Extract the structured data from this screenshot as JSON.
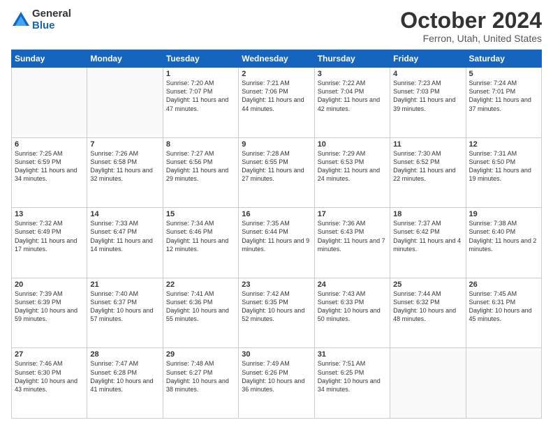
{
  "header": {
    "logo_general": "General",
    "logo_blue": "Blue",
    "month_title": "October 2024",
    "location": "Ferron, Utah, United States"
  },
  "days_of_week": [
    "Sunday",
    "Monday",
    "Tuesday",
    "Wednesday",
    "Thursday",
    "Friday",
    "Saturday"
  ],
  "weeks": [
    [
      {
        "num": "",
        "sunrise": "",
        "sunset": "",
        "daylight": ""
      },
      {
        "num": "",
        "sunrise": "",
        "sunset": "",
        "daylight": ""
      },
      {
        "num": "1",
        "sunrise": "Sunrise: 7:20 AM",
        "sunset": "Sunset: 7:07 PM",
        "daylight": "Daylight: 11 hours and 47 minutes."
      },
      {
        "num": "2",
        "sunrise": "Sunrise: 7:21 AM",
        "sunset": "Sunset: 7:06 PM",
        "daylight": "Daylight: 11 hours and 44 minutes."
      },
      {
        "num": "3",
        "sunrise": "Sunrise: 7:22 AM",
        "sunset": "Sunset: 7:04 PM",
        "daylight": "Daylight: 11 hours and 42 minutes."
      },
      {
        "num": "4",
        "sunrise": "Sunrise: 7:23 AM",
        "sunset": "Sunset: 7:03 PM",
        "daylight": "Daylight: 11 hours and 39 minutes."
      },
      {
        "num": "5",
        "sunrise": "Sunrise: 7:24 AM",
        "sunset": "Sunset: 7:01 PM",
        "daylight": "Daylight: 11 hours and 37 minutes."
      }
    ],
    [
      {
        "num": "6",
        "sunrise": "Sunrise: 7:25 AM",
        "sunset": "Sunset: 6:59 PM",
        "daylight": "Daylight: 11 hours and 34 minutes."
      },
      {
        "num": "7",
        "sunrise": "Sunrise: 7:26 AM",
        "sunset": "Sunset: 6:58 PM",
        "daylight": "Daylight: 11 hours and 32 minutes."
      },
      {
        "num": "8",
        "sunrise": "Sunrise: 7:27 AM",
        "sunset": "Sunset: 6:56 PM",
        "daylight": "Daylight: 11 hours and 29 minutes."
      },
      {
        "num": "9",
        "sunrise": "Sunrise: 7:28 AM",
        "sunset": "Sunset: 6:55 PM",
        "daylight": "Daylight: 11 hours and 27 minutes."
      },
      {
        "num": "10",
        "sunrise": "Sunrise: 7:29 AM",
        "sunset": "Sunset: 6:53 PM",
        "daylight": "Daylight: 11 hours and 24 minutes."
      },
      {
        "num": "11",
        "sunrise": "Sunrise: 7:30 AM",
        "sunset": "Sunset: 6:52 PM",
        "daylight": "Daylight: 11 hours and 22 minutes."
      },
      {
        "num": "12",
        "sunrise": "Sunrise: 7:31 AM",
        "sunset": "Sunset: 6:50 PM",
        "daylight": "Daylight: 11 hours and 19 minutes."
      }
    ],
    [
      {
        "num": "13",
        "sunrise": "Sunrise: 7:32 AM",
        "sunset": "Sunset: 6:49 PM",
        "daylight": "Daylight: 11 hours and 17 minutes."
      },
      {
        "num": "14",
        "sunrise": "Sunrise: 7:33 AM",
        "sunset": "Sunset: 6:47 PM",
        "daylight": "Daylight: 11 hours and 14 minutes."
      },
      {
        "num": "15",
        "sunrise": "Sunrise: 7:34 AM",
        "sunset": "Sunset: 6:46 PM",
        "daylight": "Daylight: 11 hours and 12 minutes."
      },
      {
        "num": "16",
        "sunrise": "Sunrise: 7:35 AM",
        "sunset": "Sunset: 6:44 PM",
        "daylight": "Daylight: 11 hours and 9 minutes."
      },
      {
        "num": "17",
        "sunrise": "Sunrise: 7:36 AM",
        "sunset": "Sunset: 6:43 PM",
        "daylight": "Daylight: 11 hours and 7 minutes."
      },
      {
        "num": "18",
        "sunrise": "Sunrise: 7:37 AM",
        "sunset": "Sunset: 6:42 PM",
        "daylight": "Daylight: 11 hours and 4 minutes."
      },
      {
        "num": "19",
        "sunrise": "Sunrise: 7:38 AM",
        "sunset": "Sunset: 6:40 PM",
        "daylight": "Daylight: 11 hours and 2 minutes."
      }
    ],
    [
      {
        "num": "20",
        "sunrise": "Sunrise: 7:39 AM",
        "sunset": "Sunset: 6:39 PM",
        "daylight": "Daylight: 10 hours and 59 minutes."
      },
      {
        "num": "21",
        "sunrise": "Sunrise: 7:40 AM",
        "sunset": "Sunset: 6:37 PM",
        "daylight": "Daylight: 10 hours and 57 minutes."
      },
      {
        "num": "22",
        "sunrise": "Sunrise: 7:41 AM",
        "sunset": "Sunset: 6:36 PM",
        "daylight": "Daylight: 10 hours and 55 minutes."
      },
      {
        "num": "23",
        "sunrise": "Sunrise: 7:42 AM",
        "sunset": "Sunset: 6:35 PM",
        "daylight": "Daylight: 10 hours and 52 minutes."
      },
      {
        "num": "24",
        "sunrise": "Sunrise: 7:43 AM",
        "sunset": "Sunset: 6:33 PM",
        "daylight": "Daylight: 10 hours and 50 minutes."
      },
      {
        "num": "25",
        "sunrise": "Sunrise: 7:44 AM",
        "sunset": "Sunset: 6:32 PM",
        "daylight": "Daylight: 10 hours and 48 minutes."
      },
      {
        "num": "26",
        "sunrise": "Sunrise: 7:45 AM",
        "sunset": "Sunset: 6:31 PM",
        "daylight": "Daylight: 10 hours and 45 minutes."
      }
    ],
    [
      {
        "num": "27",
        "sunrise": "Sunrise: 7:46 AM",
        "sunset": "Sunset: 6:30 PM",
        "daylight": "Daylight: 10 hours and 43 minutes."
      },
      {
        "num": "28",
        "sunrise": "Sunrise: 7:47 AM",
        "sunset": "Sunset: 6:28 PM",
        "daylight": "Daylight: 10 hours and 41 minutes."
      },
      {
        "num": "29",
        "sunrise": "Sunrise: 7:48 AM",
        "sunset": "Sunset: 6:27 PM",
        "daylight": "Daylight: 10 hours and 38 minutes."
      },
      {
        "num": "30",
        "sunrise": "Sunrise: 7:49 AM",
        "sunset": "Sunset: 6:26 PM",
        "daylight": "Daylight: 10 hours and 36 minutes."
      },
      {
        "num": "31",
        "sunrise": "Sunrise: 7:51 AM",
        "sunset": "Sunset: 6:25 PM",
        "daylight": "Daylight: 10 hours and 34 minutes."
      },
      {
        "num": "",
        "sunrise": "",
        "sunset": "",
        "daylight": ""
      },
      {
        "num": "",
        "sunrise": "",
        "sunset": "",
        "daylight": ""
      }
    ]
  ]
}
